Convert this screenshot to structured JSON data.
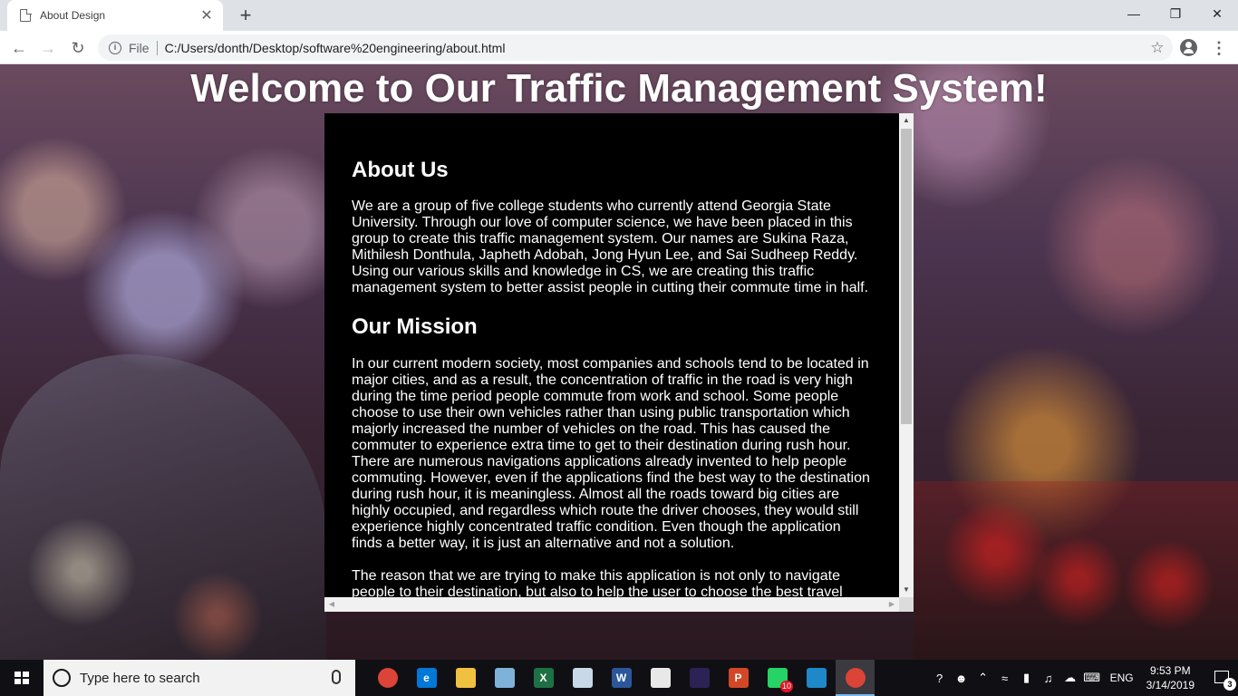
{
  "browser": {
    "tab_title": "About Design",
    "tab_close": "✕",
    "new_tab": "+",
    "file_label": "File",
    "url": "C:/Users/donth/Desktop/software%20engineering/about.html",
    "window_controls": {
      "minimize": "—",
      "maximize": "❐",
      "close": "✕"
    }
  },
  "page": {
    "title": "Welcome to Our Traffic Management System!",
    "sections": [
      {
        "heading": "About Us",
        "paragraphs": [
          "We are a group of five college students who currently attend Georgia State University. Through our love of computer science, we have been placed in this group to create this traffic management system. Our names are Sukina Raza, Mithilesh Donthula, Japheth Adobah, Jong Hyun Lee, and Sai Sudheep Reddy. Using our various skills and knowledge in CS, we are creating this traffic management system to better assist people in cutting their commute time in half."
        ]
      },
      {
        "heading": "Our Mission",
        "paragraphs": [
          "In our current modern society, most companies and schools tend to be located in major cities, and as a result, the concentration of traffic in the road is very high during the time period people commute from work and school. Some people choose to use their own vehicles rather than using public transportation which majorly increased the number of vehicles on the road. This has caused the commuter to experience extra time to get to their destination during rush hour. There are numerous navigations applications already invented to help people commuting. However, even if the applications find the best way to the destination during rush hour, it is meaningless. Almost all the roads toward big cities are highly occupied, and regardless which route the driver chooses, they would still experience highly concentrated traffic condition. Even though the application finds a better way, it is just an alternative and not a solution.",
          "The reason that we are trying to make this application is not only to navigate people to their destination, but also to help the user to choose the best travel"
        ]
      }
    ]
  },
  "taskbar": {
    "search_placeholder": "Type here to search",
    "apps": [
      {
        "name": "chrome",
        "color": "#db4437",
        "label": ""
      },
      {
        "name": "edge",
        "color": "#0078d7",
        "label": "e"
      },
      {
        "name": "file-explorer",
        "color": "#f0c040",
        "label": ""
      },
      {
        "name": "notepad",
        "color": "#7fb2d9",
        "label": ""
      },
      {
        "name": "excel",
        "color": "#1e7145",
        "label": "X"
      },
      {
        "name": "paint",
        "color": "#c8d8e8",
        "label": ""
      },
      {
        "name": "word",
        "color": "#2b579a",
        "label": "W"
      },
      {
        "name": "store",
        "color": "#e8e8e8",
        "label": ""
      },
      {
        "name": "eclipse",
        "color": "#2c2255",
        "label": ""
      },
      {
        "name": "powerpoint",
        "color": "#d24726",
        "label": "P"
      },
      {
        "name": "whatsapp",
        "color": "#25d366",
        "label": "",
        "badge": "10"
      },
      {
        "name": "remote",
        "color": "#1e88c8",
        "label": ""
      },
      {
        "name": "chrome-active",
        "color": "#db4437",
        "label": ""
      }
    ],
    "lang": "ENG",
    "time": "9:53 PM",
    "date": "3/14/2019",
    "notification_count": "3"
  }
}
